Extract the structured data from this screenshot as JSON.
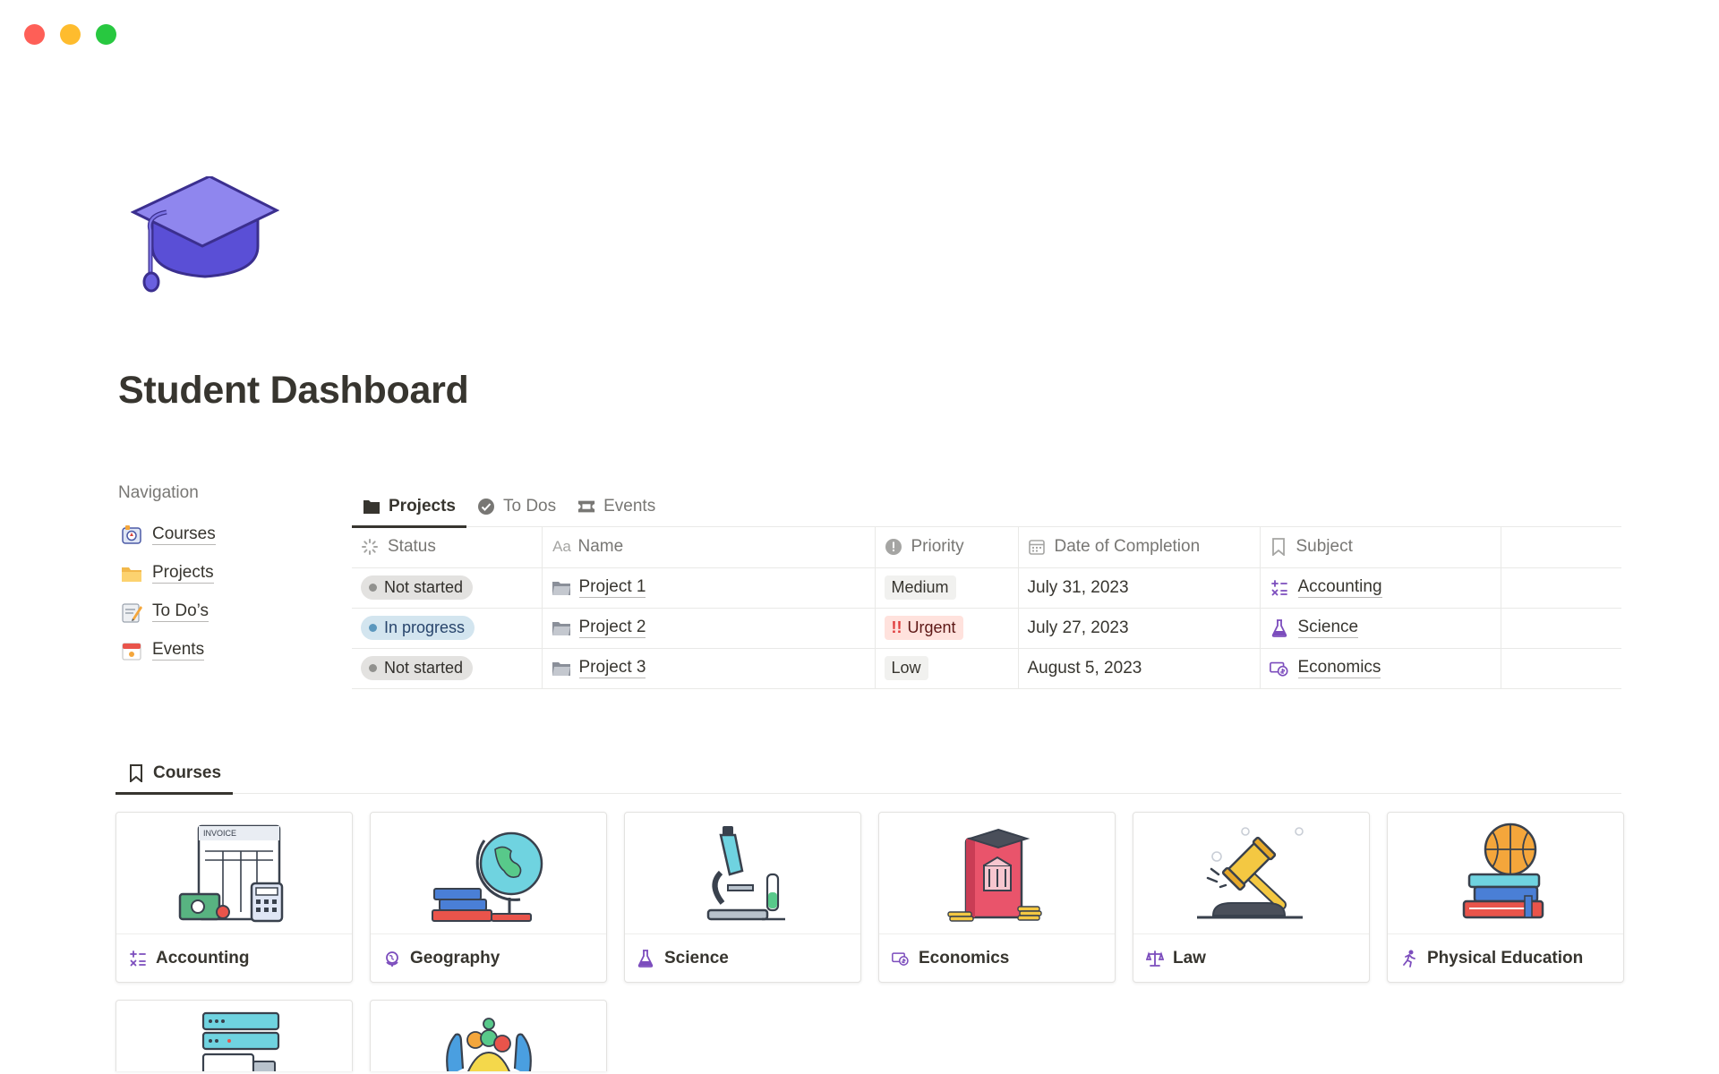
{
  "window": {
    "controls": [
      "close",
      "minimize",
      "zoom"
    ]
  },
  "page": {
    "title": "Student Dashboard",
    "icon": "graduation-cap-icon"
  },
  "navigation": {
    "heading": "Navigation",
    "items": [
      {
        "label": "Courses",
        "icon": "compass-icon"
      },
      {
        "label": "Projects",
        "icon": "folder-icon"
      },
      {
        "label": "To Do’s",
        "icon": "memo-icon"
      },
      {
        "label": "Events",
        "icon": "calendar-icon"
      }
    ]
  },
  "projects_db": {
    "tabs": [
      {
        "label": "Projects",
        "icon": "folder-icon",
        "active": true
      },
      {
        "label": "To Dos",
        "icon": "check-circle-icon",
        "active": false
      },
      {
        "label": "Events",
        "icon": "ticket-icon",
        "active": false
      }
    ],
    "columns": [
      {
        "label": "Status",
        "icon": "status-icon"
      },
      {
        "label": "Name",
        "icon": "text-icon",
        "icon_text": "Aa"
      },
      {
        "label": "Priority",
        "icon": "priority-icon"
      },
      {
        "label": "Date of Completion",
        "icon": "calendar-icon"
      },
      {
        "label": "Subject",
        "icon": "bookmark-icon"
      },
      {
        "label": ""
      }
    ],
    "rows": [
      {
        "status": "Not started",
        "name": "Project 1",
        "priority": "Medium",
        "date": "July 31, 2023",
        "subject": "Accounting"
      },
      {
        "status": "In progress",
        "name": "Project 2",
        "priority_mark": "!!",
        "priority": "Urgent",
        "date": "July 27, 2023",
        "subject": "Science"
      },
      {
        "status": "Not started",
        "name": "Project 3",
        "priority": "Low",
        "date": "August 5, 2023",
        "subject": "Economics"
      }
    ]
  },
  "courses_db": {
    "tab": {
      "label": "Courses",
      "icon": "bookmark-icon"
    },
    "cards": [
      {
        "label": "Accounting",
        "icon": "calculator-symbols-icon"
      },
      {
        "label": "Geography",
        "icon": "globe-icon"
      },
      {
        "label": "Science",
        "icon": "flask-icon"
      },
      {
        "label": "Economics",
        "icon": "money-icon"
      },
      {
        "label": "Law",
        "icon": "scales-icon"
      },
      {
        "label": "Physical Education",
        "icon": "running-icon"
      }
    ]
  },
  "colors": {
    "accent_purple": "#7c4dbd",
    "status_gray": "#e3e2e0",
    "status_blue": "#d3e5ef",
    "urgent_red": "#ffe2dd"
  }
}
